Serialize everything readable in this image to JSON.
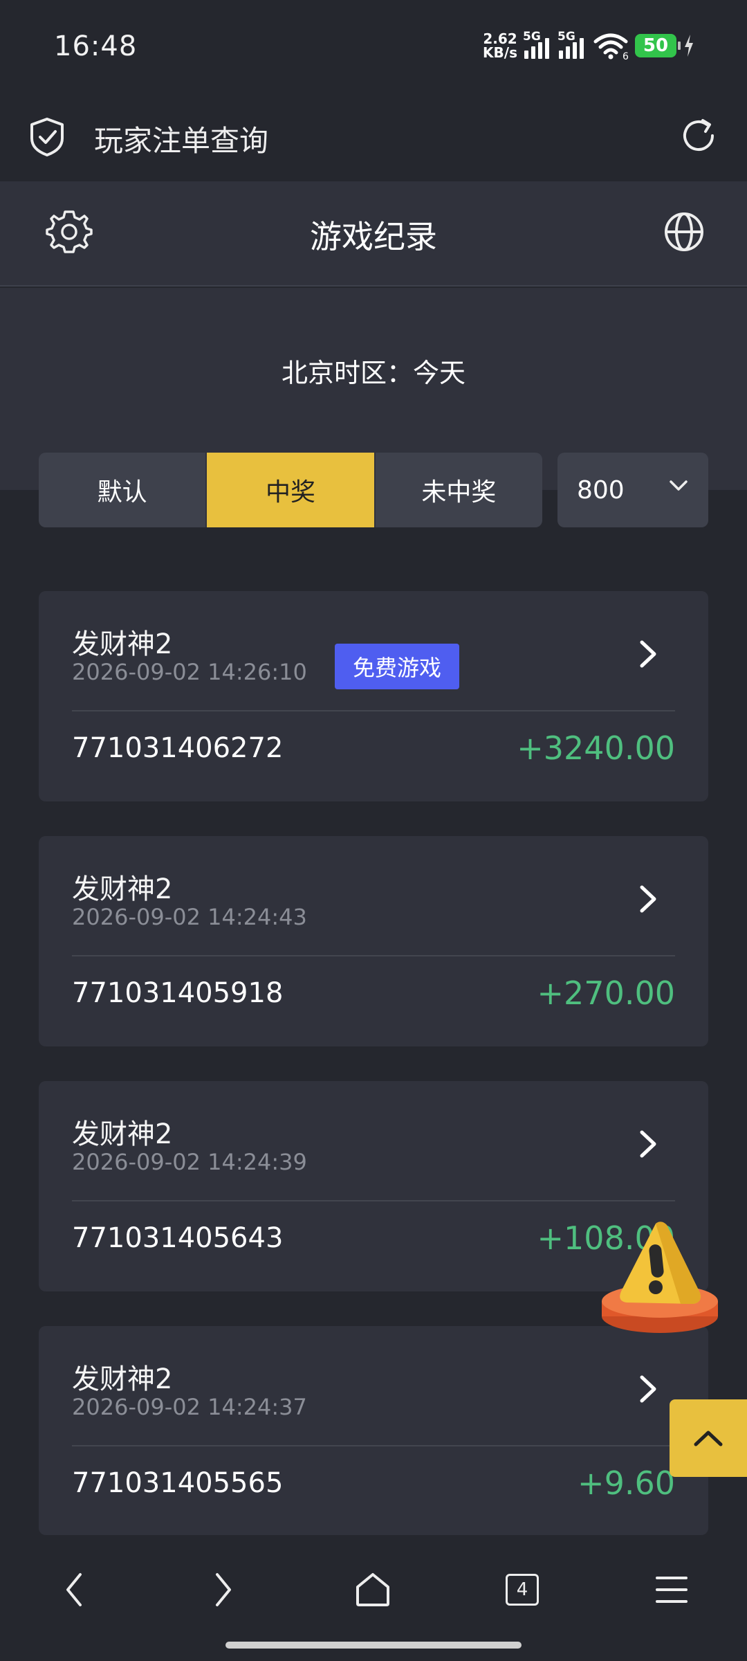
{
  "status_bar": {
    "time": "16:48",
    "net_speed_value": "2.62",
    "net_speed_unit": "KB/s",
    "signal1_label": "5G",
    "signal2_label": "5G",
    "wifi_label": "6",
    "battery": "50"
  },
  "browser_bar": {
    "title": "玩家注单查询"
  },
  "header": {
    "title": "游戏纪录"
  },
  "timezone": {
    "label": "北京时区：今天"
  },
  "filter": {
    "options": [
      "默认",
      "中奖",
      "未中奖"
    ],
    "active_index": 1,
    "page_size": "800"
  },
  "records": [
    {
      "game": "发财神2",
      "time": "2026-09-02 14:26:10",
      "badge": "免费游戏",
      "order_id": "771031406272",
      "amount": "+3240.00"
    },
    {
      "game": "发财神2",
      "time": "2026-09-02 14:24:43",
      "order_id": "771031405918",
      "amount": "+270.00"
    },
    {
      "game": "发财神2",
      "time": "2026-09-02 14:24:39",
      "order_id": "771031405643",
      "amount": "+108.00"
    },
    {
      "game": "发财神2",
      "time": "2026-09-02 14:24:37",
      "order_id": "771031405565",
      "amount": "+9.60"
    }
  ],
  "bottom_nav": {
    "tab_count": "4"
  },
  "colors": {
    "accent": "#e8c03e",
    "positive": "#4fbf7f",
    "badge": "#4f5ef0",
    "background": "#25272e",
    "card": "#30323c"
  }
}
